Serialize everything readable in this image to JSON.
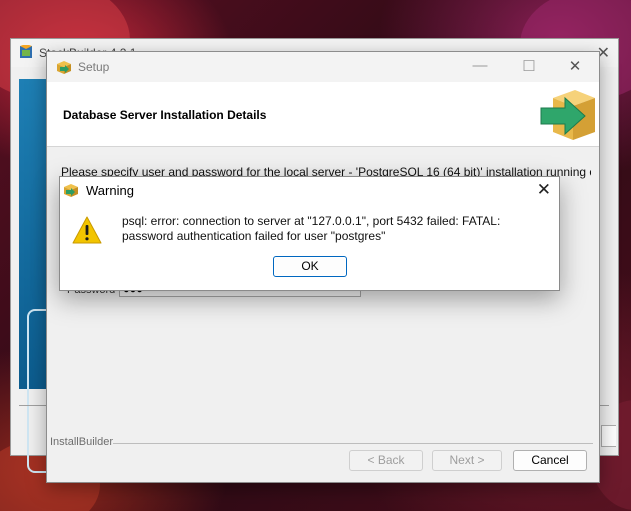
{
  "back_window": {
    "title": "StackBuilder 4.2.1"
  },
  "setup": {
    "title": "Setup",
    "header_title": "Database Server Installation Details",
    "instructions": "Please specify user and password for the local server - 'PostgreSQL 16 (64 bit)' installation running on port",
    "password_label": "Password",
    "password_mask": "●●●",
    "footer_label": "InstallBuilder",
    "buttons": {
      "back": "< Back",
      "next": "Next >",
      "cancel": "Cancel"
    }
  },
  "warning": {
    "title": "Warning",
    "message": "psql: error: connection to server at \"127.0.0.1\", port 5432 failed: FATAL:  password authentication failed for user \"postgres\"",
    "ok_label": "OK"
  },
  "icons": {
    "app": "installbuilder-box-icon",
    "warning": "warning-triangle-icon",
    "close": "close-icon",
    "minimize": "minimize-icon",
    "maximize": "maximize-icon"
  },
  "colors": {
    "accent": "#0067c0",
    "warning_yellow": "#f2c400"
  }
}
